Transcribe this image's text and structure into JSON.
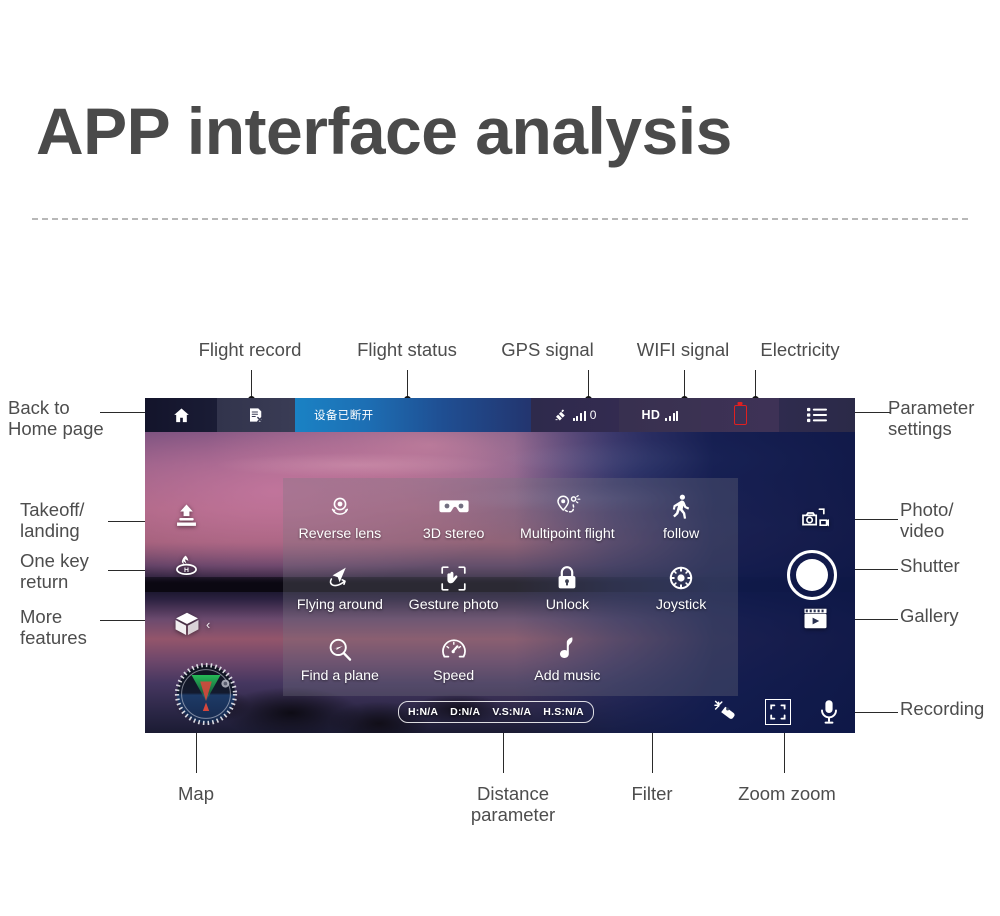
{
  "page": {
    "title": "APP interface analysis"
  },
  "annotations": {
    "top": [
      {
        "label": "Flight record"
      },
      {
        "label": "Flight status"
      },
      {
        "label": "GPS signal"
      },
      {
        "label": "WIFI signal"
      },
      {
        "label": "Electricity"
      }
    ],
    "left": [
      {
        "label": "Back to\nHome page"
      },
      {
        "label": "Takeoff/\nlanding"
      },
      {
        "label": "One key\nreturn"
      },
      {
        "label": "More\nfeatures"
      }
    ],
    "right": [
      {
        "label": "Parameter\nsettings"
      },
      {
        "label": "Photo/\nvideo"
      },
      {
        "label": "Shutter"
      },
      {
        "label": "Gallery"
      },
      {
        "label": "Recording"
      }
    ],
    "bottom": [
      {
        "label": "Map"
      },
      {
        "label": "Distance\nparameter"
      },
      {
        "label": "Filter"
      },
      {
        "label": "Zoom zoom"
      }
    ]
  },
  "app": {
    "top_bar": {
      "home_icon": "home-icon",
      "flight_record_icon": "flight-record-icon",
      "status_text": "设备已断开",
      "gps_icon": "satellite-icon",
      "gps_value": "0",
      "wifi_label": "HD",
      "battery_icon": "battery-empty-icon",
      "settings_icon": "list-menu-icon"
    },
    "menu_panel": {
      "items": [
        {
          "label": "Reverse lens",
          "icon": "reverse-lens-icon"
        },
        {
          "label": "3D stereo",
          "icon": "vr-goggles-icon"
        },
        {
          "label": "Multipoint flight",
          "icon": "waypoint-pin-icon"
        },
        {
          "label": "follow",
          "icon": "walking-person-icon"
        },
        {
          "label": "Flying around",
          "icon": "orbit-plane-icon"
        },
        {
          "label": "Gesture photo",
          "icon": "gesture-hand-icon"
        },
        {
          "label": "Unlock",
          "icon": "padlock-icon"
        },
        {
          "label": "Joystick",
          "icon": "joystick-icon"
        },
        {
          "label": "Find a plane",
          "icon": "magnifier-plane-icon"
        },
        {
          "label": "Speed",
          "icon": "speedometer-icon"
        },
        {
          "label": "Add music",
          "icon": "music-note-icon"
        }
      ]
    },
    "left_controls": [
      {
        "name": "takeoff-landing",
        "icon": "takeoff-landing-icon"
      },
      {
        "name": "one-key-return",
        "icon": "return-home-icon"
      },
      {
        "name": "more-features",
        "icon": "cube-icon"
      }
    ],
    "right_controls": [
      {
        "name": "photo-video-toggle",
        "icon": "camera-video-toggle-icon"
      },
      {
        "name": "shutter",
        "icon": "shutter-circle-icon"
      },
      {
        "name": "gallery",
        "icon": "film-strip-play-icon"
      }
    ],
    "bottom_controls": [
      {
        "name": "filter",
        "icon": "magic-wand-icon"
      },
      {
        "name": "zoom-zoom",
        "icon": "focus-brackets-icon"
      },
      {
        "name": "recording",
        "icon": "microphone-icon"
      }
    ],
    "distance_parameters": [
      {
        "label": "H:N/A"
      },
      {
        "label": "D:N/A"
      },
      {
        "label": "V.S:N/A"
      },
      {
        "label": "H.S:N/A"
      }
    ],
    "map_widget": {
      "icon": "radar-compass-icon"
    }
  },
  "colors": {
    "title": "#4a4a4a",
    "divider": "#b8b8b8",
    "status_bar_blue": "#1a82c4",
    "battery_red": "#e02020",
    "leader_line": "#2a2a2a"
  }
}
